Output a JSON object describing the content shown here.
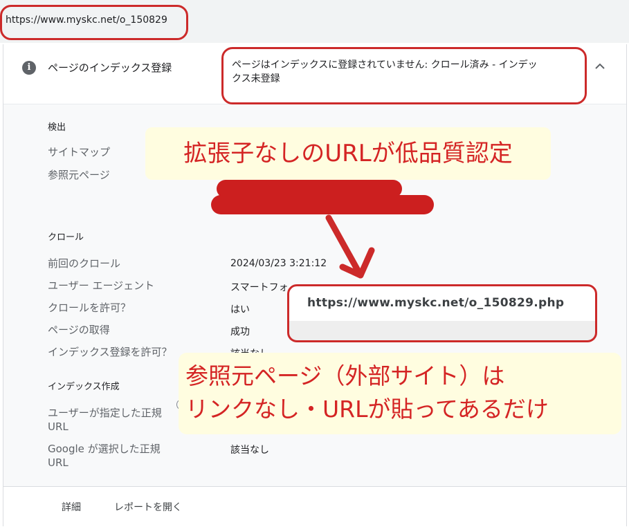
{
  "browser": {
    "url": "https://www.myskc.net/o_150829"
  },
  "header": {
    "label": "ページのインデックス登録",
    "status_line1": "ページはインデックスに登録されていません: クロール済み - インデッ",
    "status_line2": "クス未登録"
  },
  "detection": {
    "title": "検出",
    "sitemap_label": "サイトマップ",
    "referrer_label": "参照元ページ"
  },
  "crawl": {
    "title": "クロール",
    "rows": [
      {
        "label": "前回のクロール",
        "value": "2024/03/23 3:21:12"
      },
      {
        "label": "ユーザー エージェント",
        "value": "スマートフォ"
      },
      {
        "label": "クロールを許可？",
        "value": "はい"
      },
      {
        "label": "ページの取得",
        "value": "成功"
      },
      {
        "label": "インデックス登録を許可？",
        "value": "該当なし"
      }
    ]
  },
  "indexing": {
    "title": "インデックス作成",
    "user_canonical_line1": "ユーザーが指定した正規",
    "user_canonical_line2": "URL",
    "google_canonical_line1": "Google が選択した正規",
    "google_canonical_line2": "URL",
    "google_canonical_value": "該当なし"
  },
  "footer": {
    "details": "詳細",
    "open_report": "レポートを開く"
  },
  "annotations": {
    "callout1": "拡張子なしのURLが低品質認定",
    "popup_url": "https://www.myskc.net/o_150829.php",
    "callout2_line1": "参照元ページ（外部サイト）は",
    "callout2_line2": "リンクなし・URLが貼ってあるだけ"
  },
  "colors": {
    "annotation_red": "#cc2a2a",
    "callout_bg": "#fffde0",
    "panel_bg": "#f8f9fa"
  },
  "icons": {
    "info": "info-icon",
    "chevron": "chevron-up-icon",
    "help": "help-icon",
    "arrow": "arrow-down-right-icon"
  }
}
